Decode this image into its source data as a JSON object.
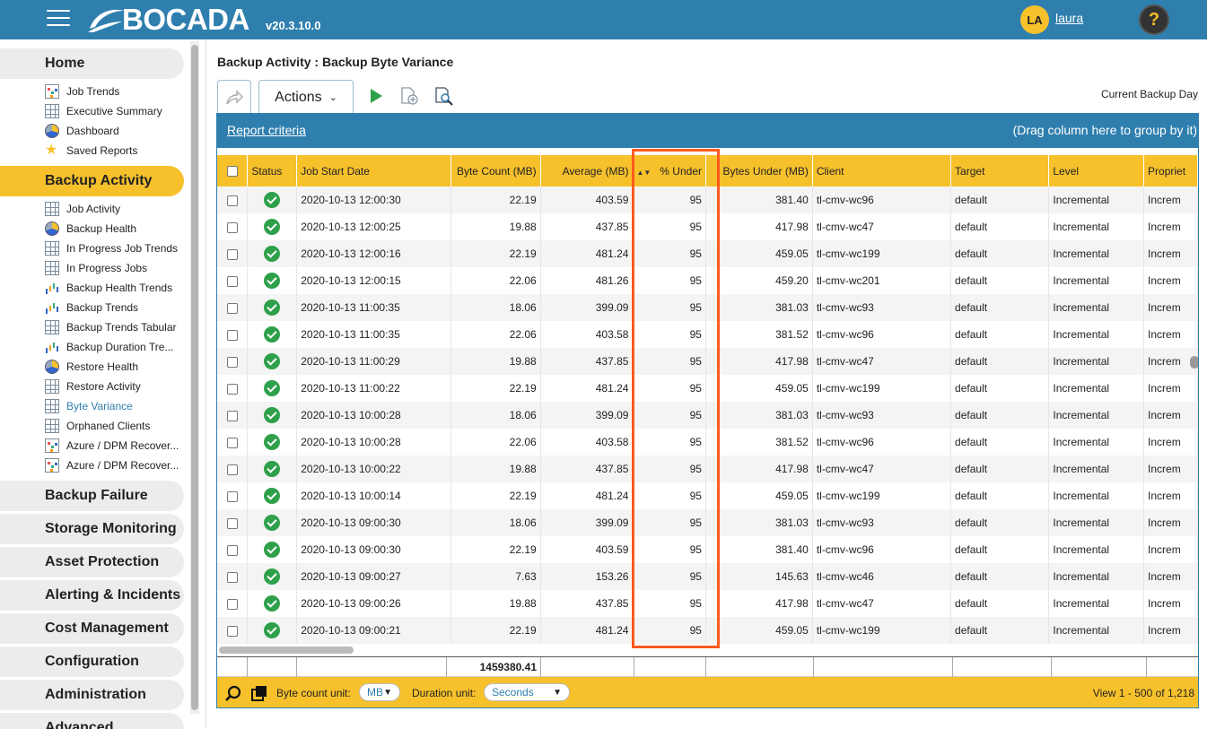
{
  "header": {
    "logo_text": "BOCADA",
    "version": "v20.3.10.0",
    "avatar_initials": "LA",
    "username": "laura",
    "help_label": "?"
  },
  "sidebar": {
    "home": "Home",
    "home_items": [
      {
        "label": "Job Trends",
        "icon": "trend-icon"
      },
      {
        "label": "Executive Summary",
        "icon": "grid-icon"
      },
      {
        "label": "Dashboard",
        "icon": "pie-icon"
      },
      {
        "label": "Saved Reports",
        "icon": "star-icon"
      }
    ],
    "backup_activity": "Backup Activity",
    "backup_items": [
      {
        "label": "Job Activity",
        "icon": "grid-icon"
      },
      {
        "label": "Backup Health",
        "icon": "pie-icon"
      },
      {
        "label": "In Progress Job Trends",
        "icon": "grid-icon"
      },
      {
        "label": "In Progress Jobs",
        "icon": "grid-icon"
      },
      {
        "label": "Backup Health Trends",
        "icon": "bar-icon"
      },
      {
        "label": "Backup Trends",
        "icon": "bar-icon"
      },
      {
        "label": "Backup Trends Tabular",
        "icon": "grid-icon"
      },
      {
        "label": "Backup Duration Tre...",
        "icon": "bar-icon"
      },
      {
        "label": "Restore Health",
        "icon": "pie-icon"
      },
      {
        "label": "Restore Activity",
        "icon": "grid-icon"
      },
      {
        "label": "Byte Variance",
        "icon": "grid-icon"
      },
      {
        "label": "Orphaned Clients",
        "icon": "grid-icon"
      },
      {
        "label": "Azure / DPM Recover...",
        "icon": "trend-icon"
      },
      {
        "label": "Azure / DPM Recover...",
        "icon": "trend-icon"
      }
    ],
    "sections": [
      "Backup Failure",
      "Storage Monitoring",
      "Asset Protection",
      "Alerting & Incidents",
      "Cost Management",
      "Configuration",
      "Administration",
      "Advanced"
    ]
  },
  "main": {
    "breadcrumb": "Backup Activity : Backup Byte Variance",
    "actions_label": "Actions",
    "current_day": "Current Backup Day",
    "report_criteria": "Report criteria",
    "drag_hint": "(Drag column here to group by it)"
  },
  "grid": {
    "columns": [
      "Status",
      "Job Start Date",
      "Byte Count (MB)",
      "Average (MB)",
      "% Under",
      "Bytes Under (MB)",
      "Client",
      "Target",
      "Level",
      "Propriet"
    ],
    "rows": [
      [
        "2020-10-13 12:00:30",
        "22.19",
        "403.59",
        "95",
        "381.40",
        "tl-cmv-wc96",
        "default",
        "Incremental",
        "Increm"
      ],
      [
        "2020-10-13 12:00:25",
        "19.88",
        "437.85",
        "95",
        "417.98",
        "tl-cmv-wc47",
        "default",
        "Incremental",
        "Increm"
      ],
      [
        "2020-10-13 12:00:16",
        "22.19",
        "481.24",
        "95",
        "459.05",
        "tl-cmv-wc199",
        "default",
        "Incremental",
        "Increm"
      ],
      [
        "2020-10-13 12:00:15",
        "22.06",
        "481.26",
        "95",
        "459.20",
        "tl-cmv-wc201",
        "default",
        "Incremental",
        "Increm"
      ],
      [
        "2020-10-13 11:00:35",
        "18.06",
        "399.09",
        "95",
        "381.03",
        "tl-cmv-wc93",
        "default",
        "Incremental",
        "Increm"
      ],
      [
        "2020-10-13 11:00:35",
        "22.06",
        "403.58",
        "95",
        "381.52",
        "tl-cmv-wc96",
        "default",
        "Incremental",
        "Increm"
      ],
      [
        "2020-10-13 11:00:29",
        "19.88",
        "437.85",
        "95",
        "417.98",
        "tl-cmv-wc47",
        "default",
        "Incremental",
        "Increm"
      ],
      [
        "2020-10-13 11:00:22",
        "22.19",
        "481.24",
        "95",
        "459.05",
        "tl-cmv-wc199",
        "default",
        "Incremental",
        "Increm"
      ],
      [
        "2020-10-13 10:00:28",
        "18.06",
        "399.09",
        "95",
        "381.03",
        "tl-cmv-wc93",
        "default",
        "Incremental",
        "Increm"
      ],
      [
        "2020-10-13 10:00:28",
        "22.06",
        "403.58",
        "95",
        "381.52",
        "tl-cmv-wc96",
        "default",
        "Incremental",
        "Increm"
      ],
      [
        "2020-10-13 10:00:22",
        "19.88",
        "437.85",
        "95",
        "417.98",
        "tl-cmv-wc47",
        "default",
        "Incremental",
        "Increm"
      ],
      [
        "2020-10-13 10:00:14",
        "22.19",
        "481.24",
        "95",
        "459.05",
        "tl-cmv-wc199",
        "default",
        "Incremental",
        "Increm"
      ],
      [
        "2020-10-13 09:00:30",
        "18.06",
        "399.09",
        "95",
        "381.03",
        "tl-cmv-wc93",
        "default",
        "Incremental",
        "Increm"
      ],
      [
        "2020-10-13 09:00:30",
        "22.19",
        "403.59",
        "95",
        "381.40",
        "tl-cmv-wc96",
        "default",
        "Incremental",
        "Increm"
      ],
      [
        "2020-10-13 09:00:27",
        "7.63",
        "153.26",
        "95",
        "145.63",
        "tl-cmv-wc46",
        "default",
        "Incremental",
        "Increm"
      ],
      [
        "2020-10-13 09:00:26",
        "19.88",
        "437.85",
        "95",
        "417.98",
        "tl-cmv-wc47",
        "default",
        "Incremental",
        "Increm"
      ],
      [
        "2020-10-13 09:00:21",
        "22.19",
        "481.24",
        "95",
        "459.05",
        "tl-cmv-wc199",
        "default",
        "Incremental",
        "Increm"
      ]
    ],
    "total_byte_count": "1459380.41"
  },
  "footer": {
    "byte_unit_label": "Byte count unit:",
    "byte_unit_value": "MB",
    "duration_unit_label": "Duration unit:",
    "duration_unit_value": "Seconds",
    "view_text": "View 1 - 500 of 1,218"
  },
  "colors": {
    "header_blue": "#2f7fae",
    "accent_yellow": "#f7c12c",
    "status_green": "#2ea04a",
    "highlight_orange": "#ff5a1f"
  }
}
